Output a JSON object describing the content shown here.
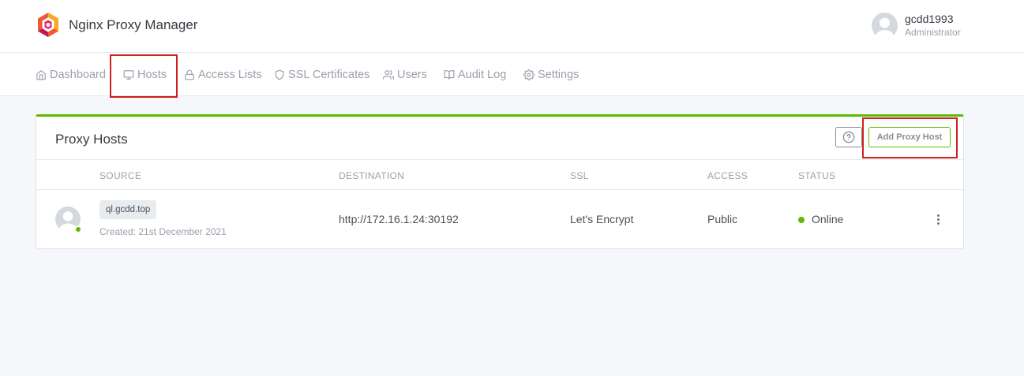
{
  "app": {
    "title": "Nginx Proxy Manager"
  },
  "user": {
    "name": "gcdd1993",
    "role": "Administrator"
  },
  "nav": {
    "items": [
      {
        "label": "Dashboard",
        "icon": "home-icon"
      },
      {
        "label": "Hosts",
        "icon": "monitor-icon"
      },
      {
        "label": "Access Lists",
        "icon": "lock-icon"
      },
      {
        "label": "SSL Certificates",
        "icon": "shield-icon"
      },
      {
        "label": "Users",
        "icon": "users-icon"
      },
      {
        "label": "Audit Log",
        "icon": "book-icon"
      },
      {
        "label": "Settings",
        "icon": "gear-icon"
      }
    ]
  },
  "card": {
    "title": "Proxy Hosts",
    "help_icon": "help-circle-icon",
    "add_label": "Add Proxy Host"
  },
  "table": {
    "headers": [
      "SOURCE",
      "DESTINATION",
      "SSL",
      "ACCESS",
      "STATUS"
    ],
    "rows": [
      {
        "source": "ql.gcdd.top",
        "created": "Created: 21st December 2021",
        "destination": "http://172.16.1.24:30192",
        "ssl": "Let's Encrypt",
        "access": "Public",
        "status": "Online"
      }
    ]
  },
  "colors": {
    "accent": "#5eba00",
    "highlight": "#cd201f",
    "online": "#5eba00"
  }
}
